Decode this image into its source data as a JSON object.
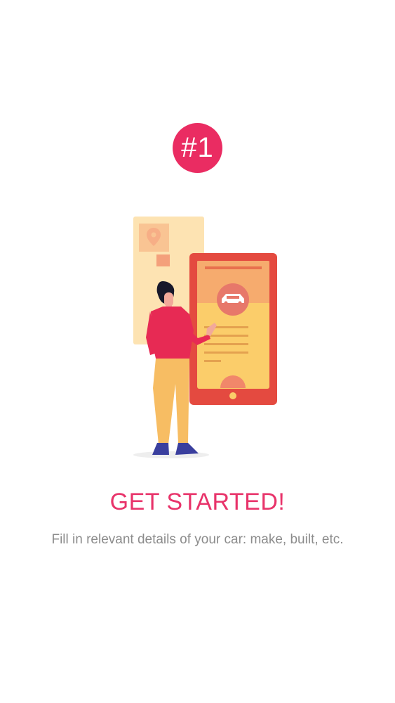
{
  "onboarding": {
    "step_badge": "#1",
    "title": "GET STARTED!",
    "subtitle": "Fill in relevant details of your car: make, built, etc."
  },
  "illustration": {
    "icons": [
      "location-pin-icon",
      "car-icon"
    ]
  },
  "colors": {
    "accent": "#ea2c62",
    "title": "#e8336a",
    "subtitle": "#8c8c8c",
    "phone_frame": "#e44a40",
    "phone_screen": "#fbcd6a",
    "map_card": "#fde2b0"
  }
}
